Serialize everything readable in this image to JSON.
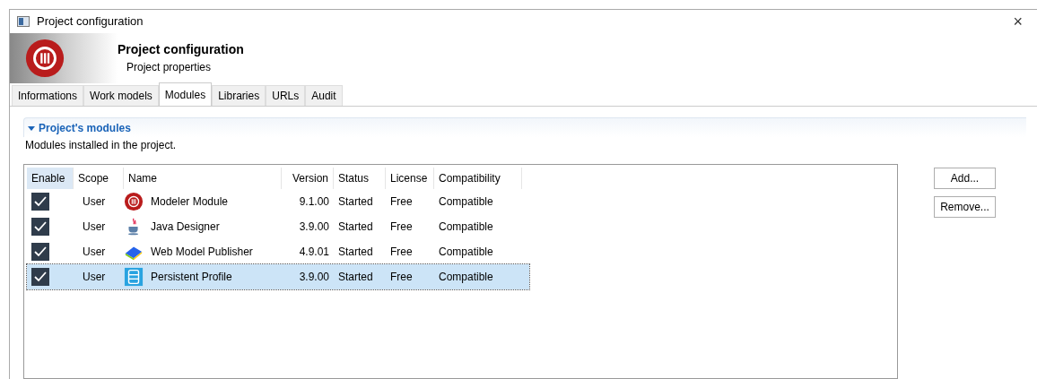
{
  "window": {
    "title": "Project configuration",
    "close": "×"
  },
  "header": {
    "title": "Project configuration",
    "subtitle": "Project properties"
  },
  "tabs": [
    {
      "label": "Informations",
      "selected": false
    },
    {
      "label": "Work models",
      "selected": false
    },
    {
      "label": "Modules",
      "selected": true
    },
    {
      "label": "Libraries",
      "selected": false
    },
    {
      "label": "URLs",
      "selected": false
    },
    {
      "label": "Audit",
      "selected": false
    }
  ],
  "section": {
    "title": "Project's modules",
    "expanded": true,
    "description": "Modules installed in the project."
  },
  "table": {
    "columns": [
      "Enable",
      "Scope",
      "Name",
      "Version",
      "Status",
      "License",
      "Compatibility"
    ],
    "rows": [
      {
        "enabled": true,
        "scope": "User",
        "kind": "modeler",
        "name": "Modeler Module",
        "version": "9.1.00",
        "status": "Started",
        "license": "Free",
        "compatibility": "Compatible",
        "selected": false
      },
      {
        "enabled": true,
        "scope": "User",
        "kind": "java",
        "name": "Java Designer",
        "version": "3.9.00",
        "status": "Started",
        "license": "Free",
        "compatibility": "Compatible",
        "selected": false
      },
      {
        "enabled": true,
        "scope": "User",
        "kind": "book",
        "name": "Web Model Publisher",
        "version": "4.9.01",
        "status": "Started",
        "license": "Free",
        "compatibility": "Compatible",
        "selected": false
      },
      {
        "enabled": true,
        "scope": "User",
        "kind": "database",
        "name": "Persistent Profile",
        "version": "3.9.00",
        "status": "Started",
        "license": "Free",
        "compatibility": "Compatible",
        "selected": true
      }
    ]
  },
  "buttons": [
    "Add...",
    "Remove..."
  ]
}
